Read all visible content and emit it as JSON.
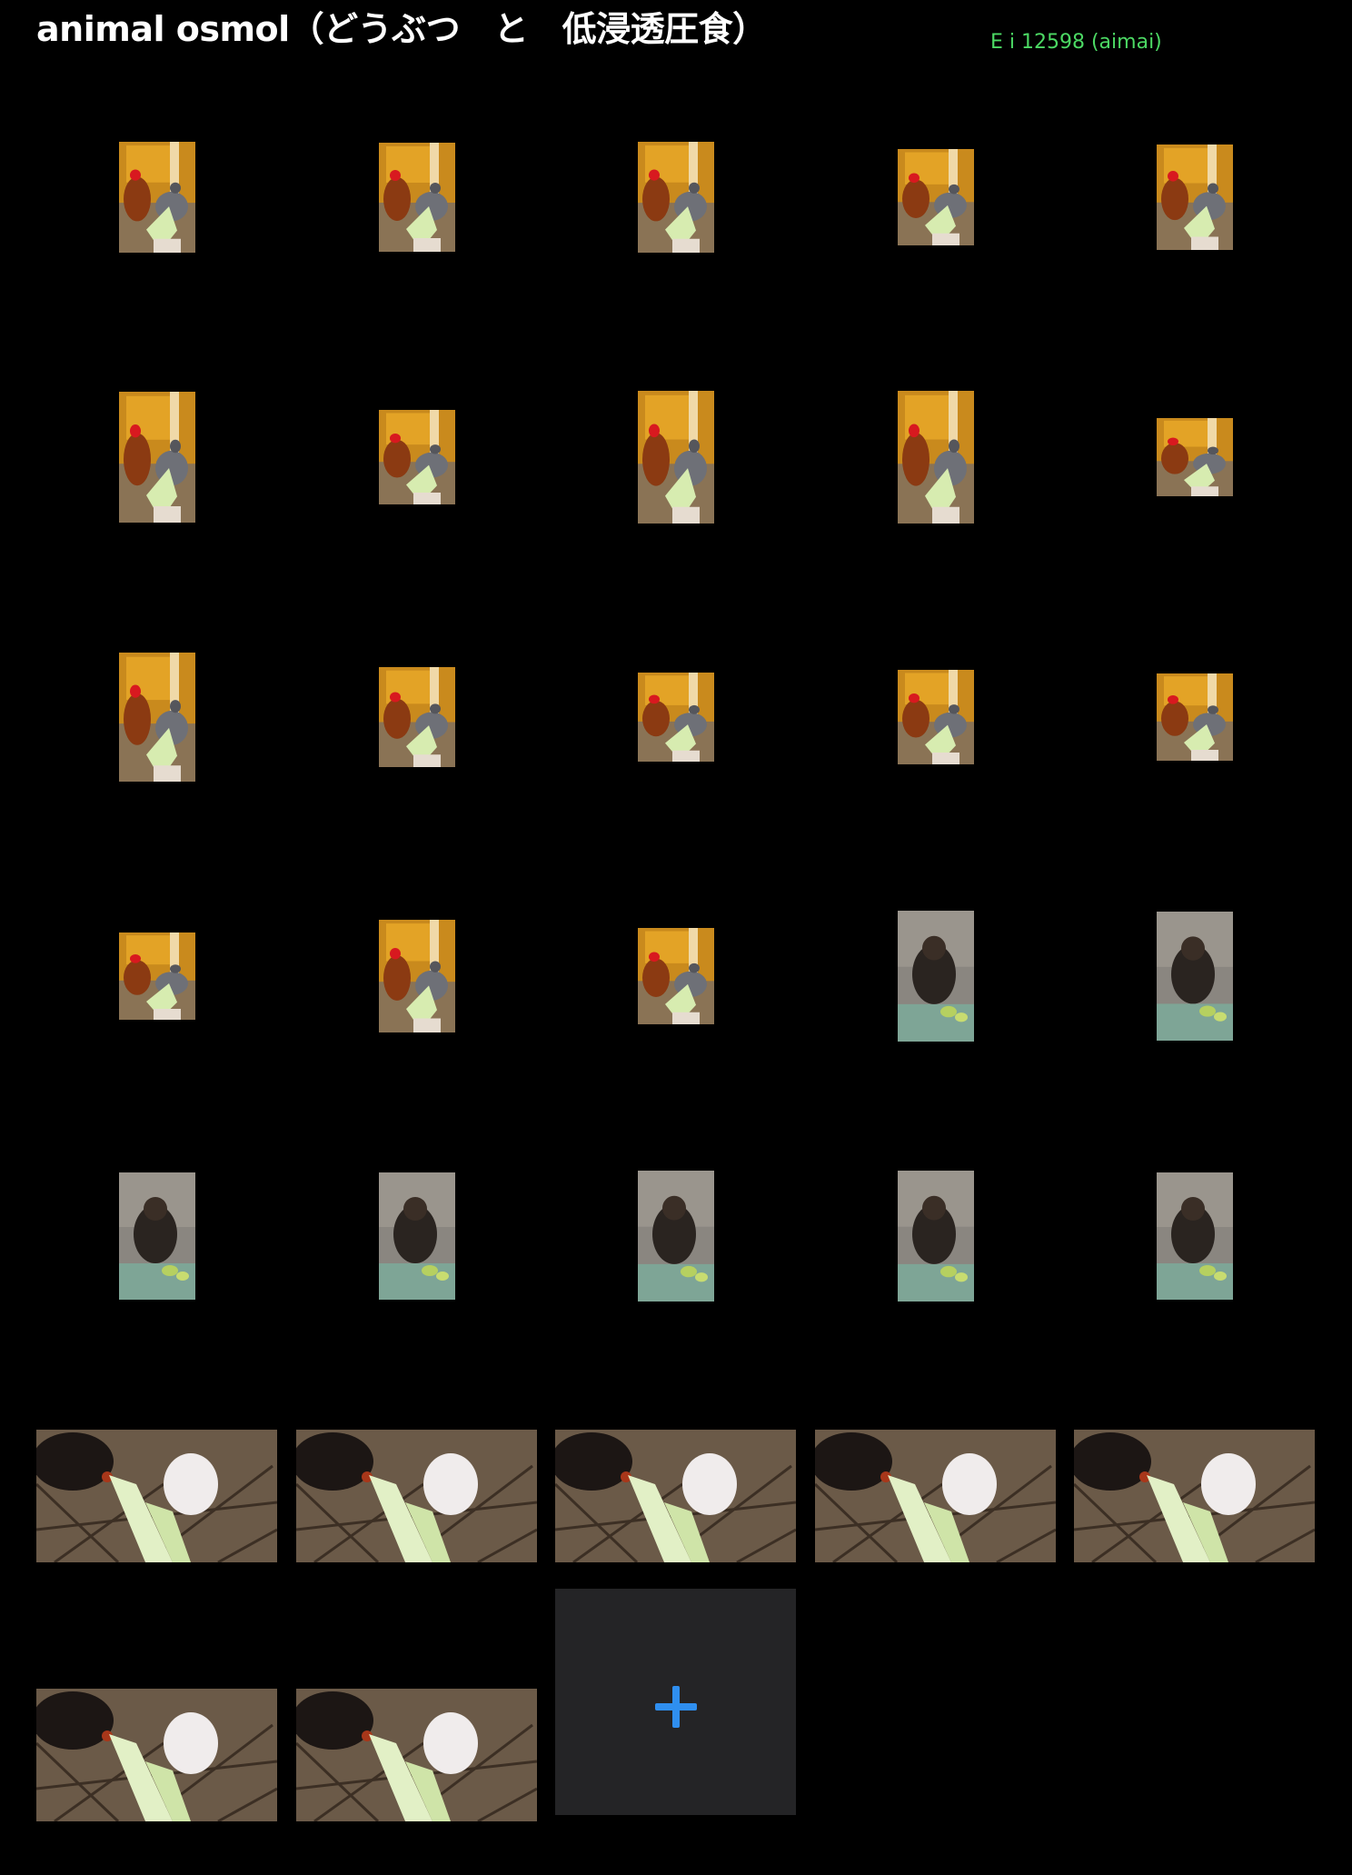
{
  "header": {
    "title": "animal osmol（どうぶつ　と　低浸透圧食）",
    "user_label": "E i 12598 (aimai)",
    "user_label_color": "#4cd964"
  },
  "grid": {
    "items": [
      {
        "scene": "chicken",
        "orientation": "portrait"
      },
      {
        "scene": "chicken",
        "orientation": "portrait"
      },
      {
        "scene": "chicken",
        "orientation": "portrait"
      },
      {
        "scene": "chicken",
        "orientation": "portrait"
      },
      {
        "scene": "chicken",
        "orientation": "portrait"
      },
      {
        "scene": "chicken",
        "orientation": "portrait"
      },
      {
        "scene": "chicken",
        "orientation": "portrait"
      },
      {
        "scene": "chicken",
        "orientation": "portrait"
      },
      {
        "scene": "chicken",
        "orientation": "portrait"
      },
      {
        "scene": "chicken",
        "orientation": "portrait"
      },
      {
        "scene": "chicken",
        "orientation": "portrait"
      },
      {
        "scene": "chicken",
        "orientation": "portrait"
      },
      {
        "scene": "chicken",
        "orientation": "portrait"
      },
      {
        "scene": "chicken",
        "orientation": "portrait"
      },
      {
        "scene": "chicken",
        "orientation": "portrait"
      },
      {
        "scene": "chicken",
        "orientation": "portrait"
      },
      {
        "scene": "chicken",
        "orientation": "portrait"
      },
      {
        "scene": "chicken",
        "orientation": "portrait"
      },
      {
        "scene": "gorilla",
        "orientation": "portrait"
      },
      {
        "scene": "gorilla",
        "orientation": "portrait"
      },
      {
        "scene": "gorilla",
        "orientation": "portrait"
      },
      {
        "scene": "gorilla",
        "orientation": "portrait"
      },
      {
        "scene": "gorilla",
        "orientation": "portrait"
      },
      {
        "scene": "gorilla",
        "orientation": "portrait"
      },
      {
        "scene": "gorilla",
        "orientation": "portrait"
      },
      {
        "scene": "rabbit-and-hen",
        "orientation": "landscape"
      },
      {
        "scene": "rabbit-and-hen",
        "orientation": "landscape"
      },
      {
        "scene": "rabbit-and-hen",
        "orientation": "landscape"
      },
      {
        "scene": "rabbit-and-hen",
        "orientation": "landscape"
      },
      {
        "scene": "rabbit-and-hen",
        "orientation": "landscape"
      },
      {
        "scene": "rabbit-and-hen",
        "orientation": "landscape"
      },
      {
        "scene": "rabbit-and-hen",
        "orientation": "landscape"
      }
    ],
    "add_button": {
      "icon": "plus-icon",
      "color": "#2f8ff0"
    }
  }
}
